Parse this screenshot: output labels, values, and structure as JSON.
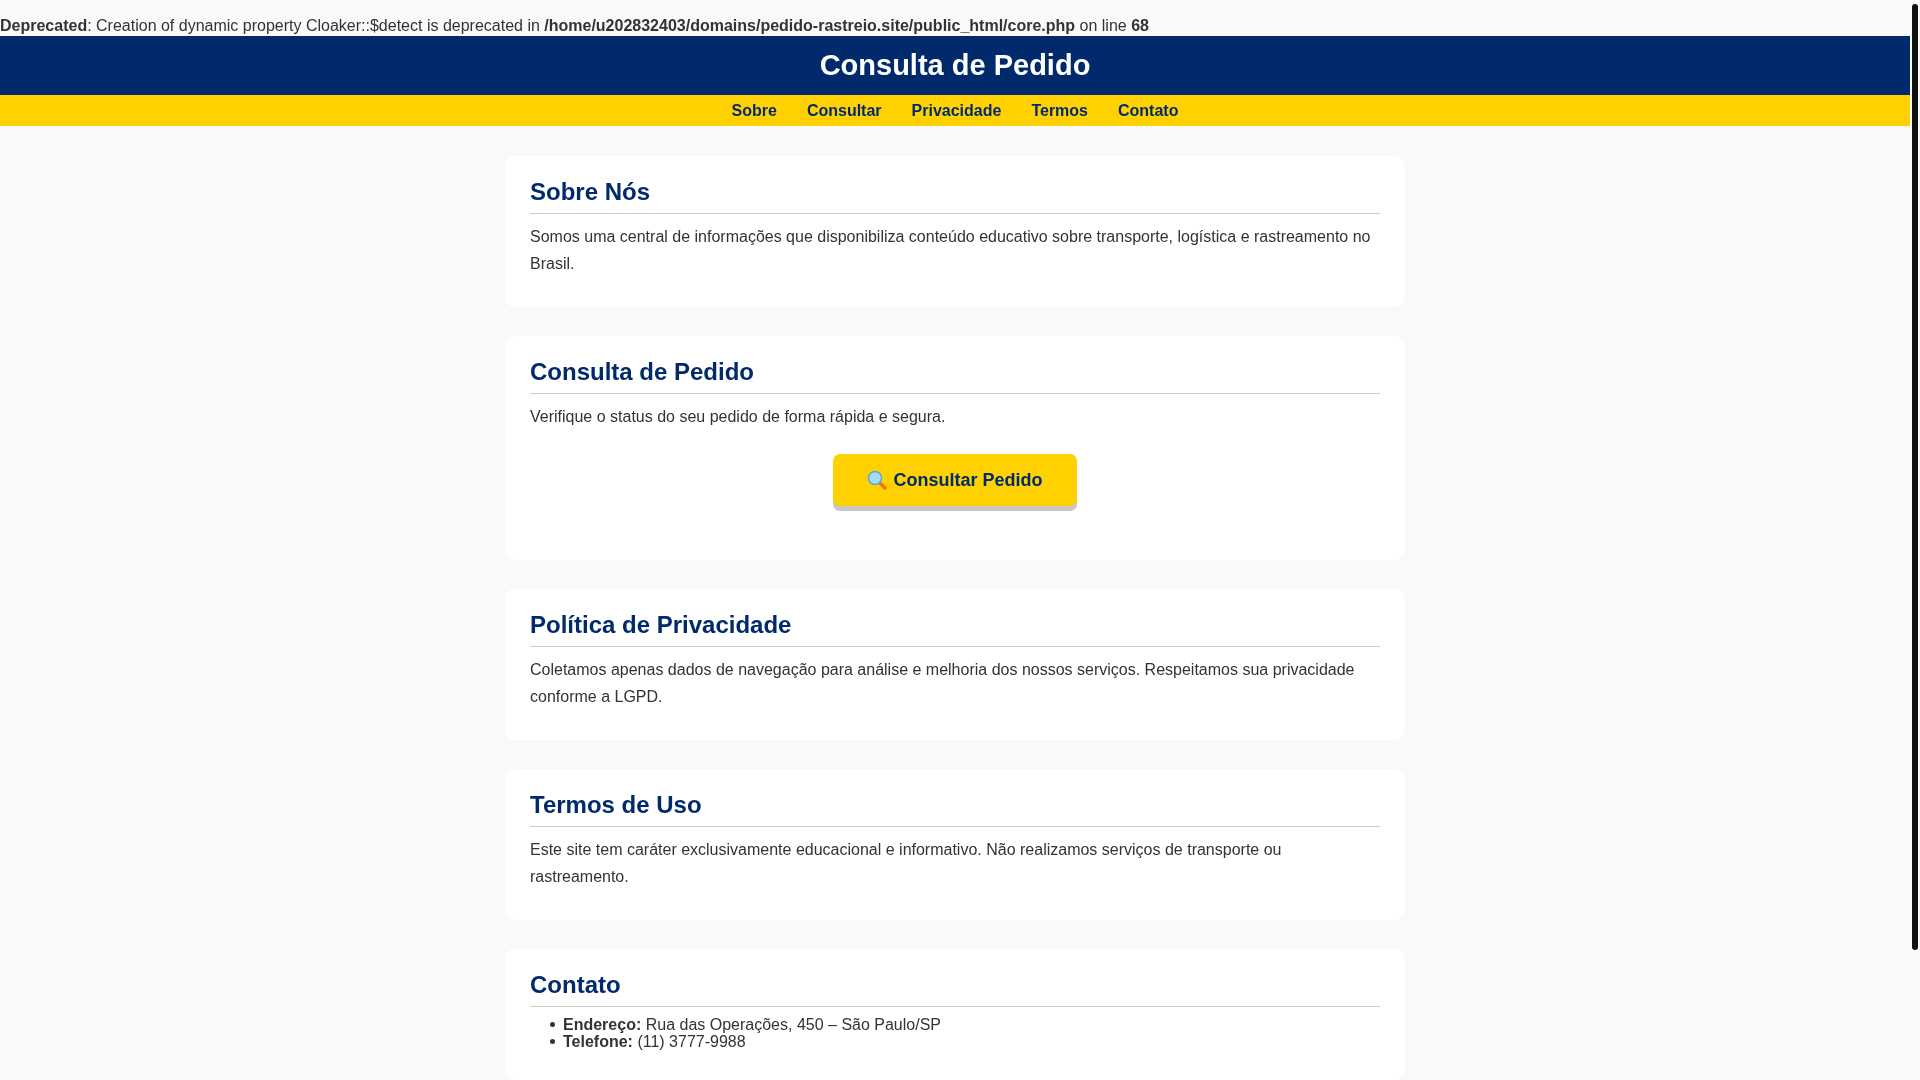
{
  "notice": "**Deprecated**: Creation of dynamic property Cloaker::$detect is deprecated in **/home/u202832403/domains/pedido-rastreio.site/public_html/core.php** on line **68**",
  "header": {
    "title": "Consulta de Pedido"
  },
  "nav": [
    "Sobre",
    "Consultar",
    "Privacidade",
    "Termos",
    "Contato"
  ],
  "sections": [
    {
      "kind": "text",
      "title": "Sobre Nós",
      "text": "Somos uma central de informações que disponibiliza conteúdo educativo sobre transporte, logística e rastreamento no Brasil."
    },
    {
      "kind": "action",
      "title": "Consulta de Pedido",
      "text": "Verifique o status do seu pedido de forma rápida e segura.",
      "button": "Consultar Pedido"
    },
    {
      "kind": "text",
      "title": "Política de Privacidade",
      "text": "Coletamos apenas dados de navegação para análise e melhoria dos nossos serviços. Respeitamos sua privacidade conforme a LGPD."
    },
    {
      "kind": "text",
      "title": "Termos de Uso",
      "text": "Este site tem caráter exclusivamente educacional e informativo. Não realizamos serviços de transporte ou rastreamento."
    },
    {
      "kind": "list",
      "title": "Contato",
      "items": [
        "**Endereço:** Rua das Operações, 450 – São Paulo/SP",
        "**Telefone:** (11) 3777-9988"
      ]
    }
  ]
}
